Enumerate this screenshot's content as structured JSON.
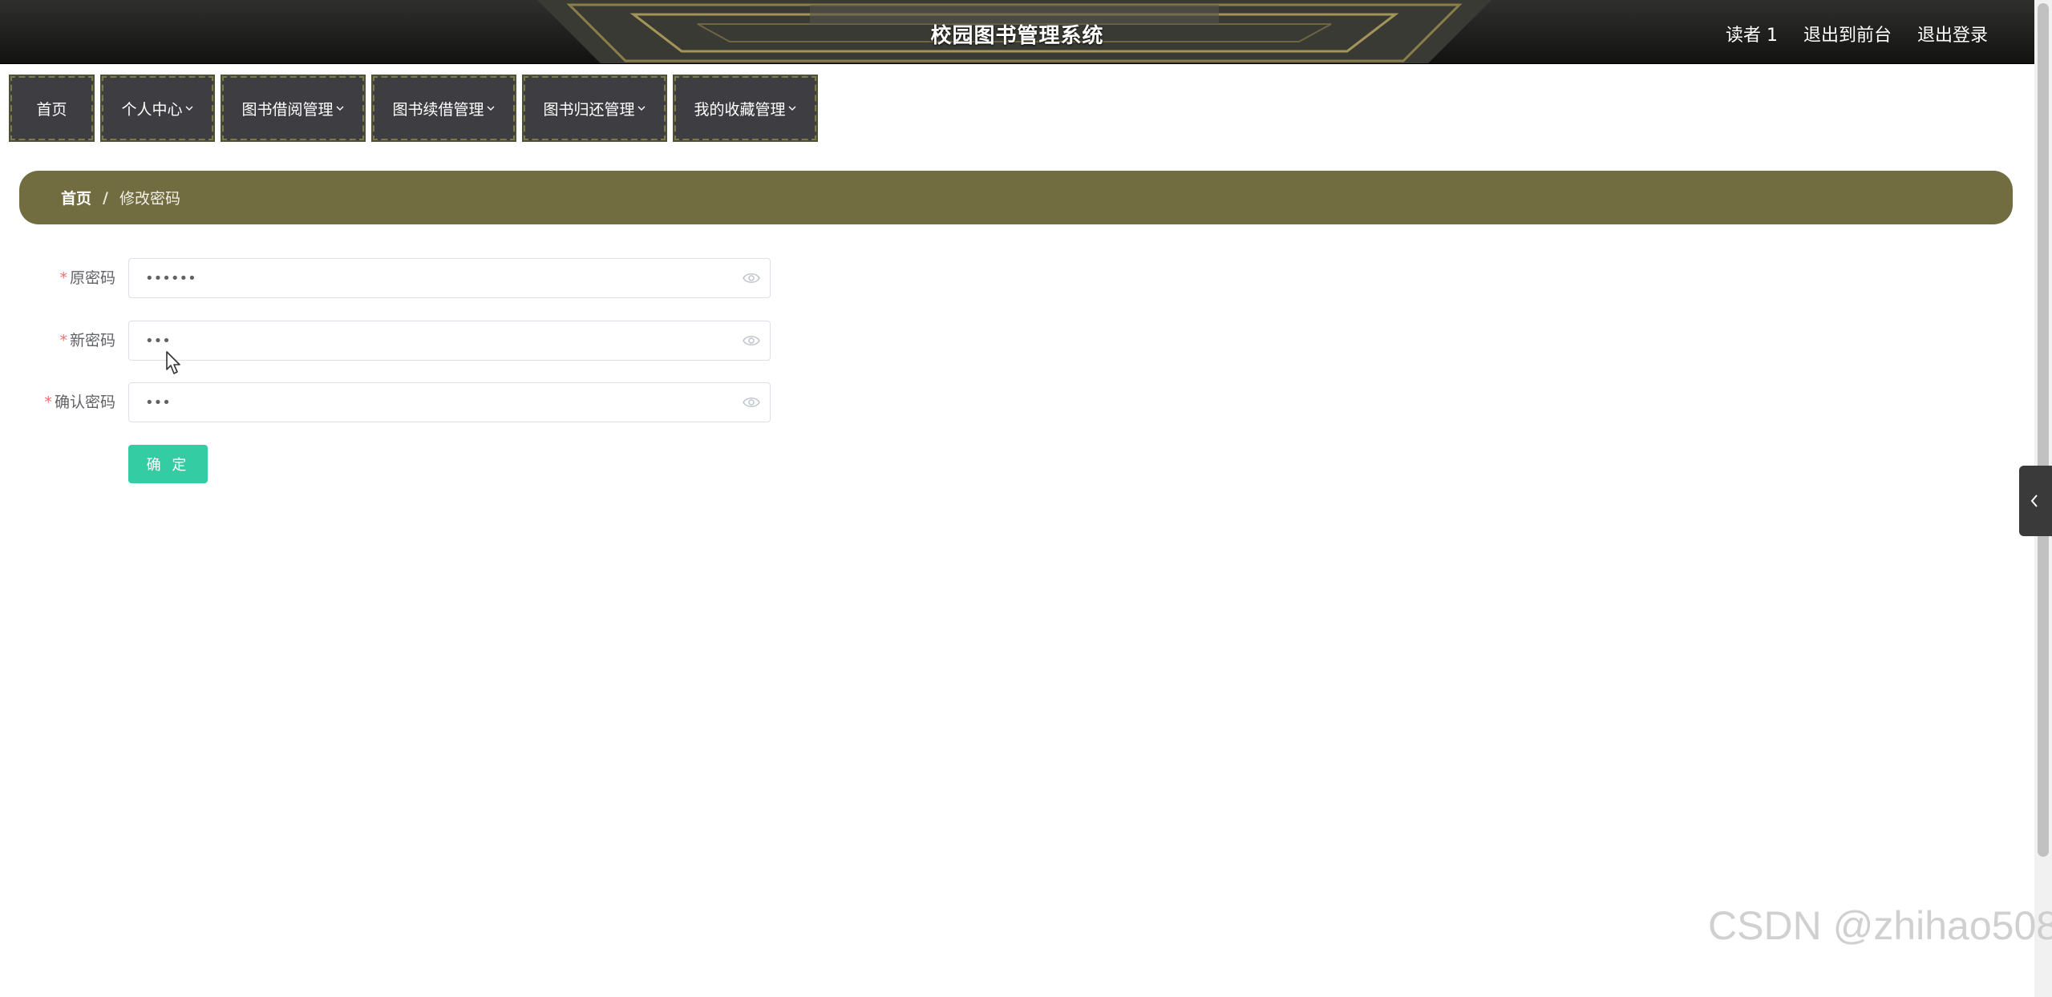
{
  "header": {
    "title": "校园图书管理系统",
    "user": "读者 1",
    "to_front": "退出到前台",
    "logout": "退出登录"
  },
  "nav": {
    "items": [
      {
        "label": "首页",
        "has_dropdown": false
      },
      {
        "label": "个人中心",
        "has_dropdown": true
      },
      {
        "label": "图书借阅管理",
        "has_dropdown": true
      },
      {
        "label": "图书续借管理",
        "has_dropdown": true
      },
      {
        "label": "图书归还管理",
        "has_dropdown": true
      },
      {
        "label": "我的收藏管理",
        "has_dropdown": true
      }
    ]
  },
  "breadcrumb": {
    "home": "首页",
    "separator": "/",
    "current": "修改密码"
  },
  "form": {
    "fields": [
      {
        "label": "原密码",
        "required": true,
        "value": "••••••"
      },
      {
        "label": "新密码",
        "required": true,
        "value": "•••"
      },
      {
        "label": "确认密码",
        "required": true,
        "value": "•••"
      }
    ],
    "submit_label": "确 定"
  },
  "watermark": "CSDN @zhihao508",
  "colors": {
    "header_bg": "#1f1f1d",
    "nav_bg": "#3d3d42",
    "breadcrumb_bg": "#726c41",
    "submit_bg": "#34cca3",
    "required": "#f56c6c"
  }
}
